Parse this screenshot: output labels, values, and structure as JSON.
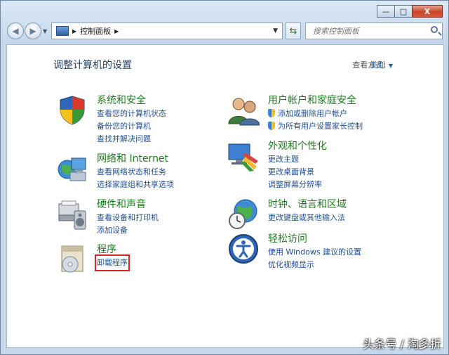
{
  "window": {
    "controls": {
      "minimize": "—",
      "maximize": "□",
      "close": "X"
    }
  },
  "nav": {
    "breadcrumb": [
      "控制面板"
    ],
    "search_placeholder": "搜索控制面板"
  },
  "header": {
    "title": "调整计算机的设置",
    "view_label": "查看方式:",
    "view_value": "类别"
  },
  "categories": [
    {
      "title": "系统和安全",
      "icon": "system-security-icon",
      "links": [
        "查看您的计算机状态",
        "备份您的计算机",
        "查找并解决问题"
      ]
    },
    {
      "title": "网络和 Internet",
      "icon": "network-icon",
      "links": [
        "查看网络状态和任务",
        "选择家庭组和共享选项"
      ]
    },
    {
      "title": "硬件和声音",
      "icon": "hardware-sound-icon",
      "links": [
        "查看设备和打印机",
        "添加设备"
      ]
    },
    {
      "title": "程序",
      "icon": "programs-icon",
      "links": [
        "卸载程序"
      ]
    },
    {
      "title": "用户帐户和家庭安全",
      "icon": "user-accounts-icon",
      "links": [
        "添加或删除用户帐户",
        "为所有用户设置家长控制"
      ]
    },
    {
      "title": "外观和个性化",
      "icon": "appearance-icon",
      "links": [
        "更改主题",
        "更改桌面背景",
        "调整屏幕分辨率"
      ]
    },
    {
      "title": "时钟、语言和区域",
      "icon": "clock-language-icon",
      "links": [
        "更改键盘或其他输入法"
      ]
    },
    {
      "title": "轻松访问",
      "icon": "ease-of-access-icon",
      "links": [
        "使用 Windows 建议的设置",
        "优化视频显示"
      ]
    }
  ],
  "watermark": "头条号 / 淘多折",
  "colors": {
    "category_title": "#1e7a1e",
    "link": "#1f4f96",
    "highlight_box": "#d3242a"
  }
}
